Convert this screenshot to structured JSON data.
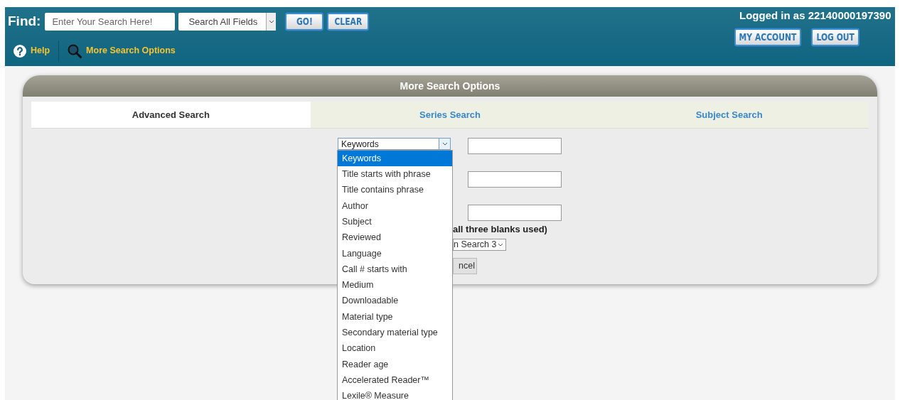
{
  "header": {
    "find_label": "Find:",
    "search": {
      "placeholder": "Enter Your Search Here!"
    },
    "field_select": {
      "value": "Search All Fields"
    },
    "buttons": [
      "GO!",
      "CLEAR"
    ],
    "login_text": "Logged in as 22140000197390",
    "account_buttons": [
      "MY ACCOUNT",
      "LOG OUT"
    ],
    "links": [
      {
        "kind": "help",
        "label": "Help"
      },
      {
        "kind": "search",
        "label": "More Search Options"
      }
    ]
  },
  "panel": {
    "title": "More Search Options",
    "tabs": [
      {
        "label": "Advanced Search",
        "selected": true
      },
      {
        "label": "Series Search",
        "selected": false
      },
      {
        "label": "Subject Search",
        "selected": false
      }
    ],
    "field_select": {
      "value": "Keywords",
      "expanded": true
    },
    "options": [
      {
        "label": "Keywords",
        "selected": true
      },
      {
        "label": "Title starts with phrase",
        "selected": false
      },
      {
        "label": "Title contains phrase",
        "selected": false
      },
      {
        "label": "Author",
        "selected": false
      },
      {
        "label": "Subject",
        "selected": false
      },
      {
        "label": "Reviewed",
        "selected": false
      },
      {
        "label": "Language",
        "selected": false
      },
      {
        "label": "Call # starts with",
        "selected": false
      },
      {
        "label": "Medium",
        "selected": false
      },
      {
        "label": "Downloadable",
        "selected": false
      },
      {
        "label": "Material type",
        "selected": false
      },
      {
        "label": "Secondary material type",
        "selected": false
      },
      {
        "label": "Location",
        "selected": false
      },
      {
        "label": "Reader age",
        "selected": false
      },
      {
        "label": "Accelerated Reader™",
        "selected": false
      },
      {
        "label": "Lexile® Measure",
        "selected": false
      }
    ],
    "note": "all three blanks used)",
    "sort_select": {
      "value": "n Search 3"
    },
    "cancel_button": "ncel"
  }
}
